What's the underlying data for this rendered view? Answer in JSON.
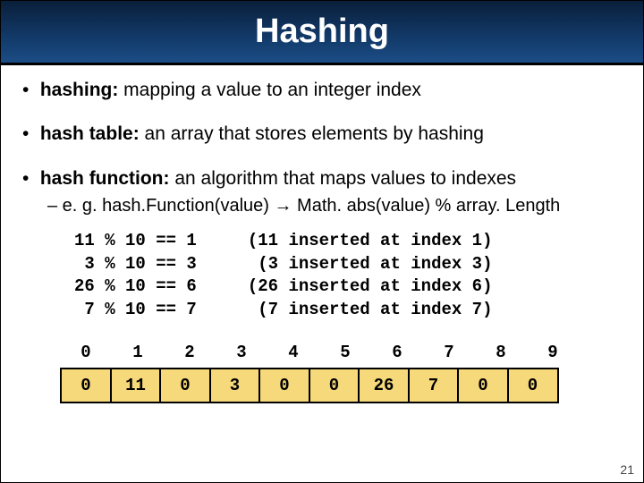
{
  "title": "Hashing",
  "bullets": [
    {
      "term": "hashing:",
      "desc": " mapping a value to an integer index"
    },
    {
      "term": "hash table:",
      "desc": " an array that stores elements by hashing"
    },
    {
      "term": "hash function:",
      "desc": " an algorithm that maps values to indexes"
    }
  ],
  "sub": {
    "prefix": "– e. g. hash.Function(value) ",
    "arrow": "→",
    "suffix": " Math. abs(value) % array. Length"
  },
  "code": "11 % 10 == 1     (11 inserted at index 1)\n 3 % 10 == 3      (3 inserted at index 3)\n26 % 10 == 6     (26 inserted at index 6)\n 7 % 10 == 7      (7 inserted at index 7)",
  "table": {
    "indexes": [
      "0",
      "1",
      "2",
      "3",
      "4",
      "5",
      "6",
      "7",
      "8",
      "9"
    ],
    "values": [
      "0",
      "11",
      "0",
      "3",
      "0",
      "0",
      "26",
      "7",
      "0",
      "0"
    ]
  },
  "page": "21"
}
